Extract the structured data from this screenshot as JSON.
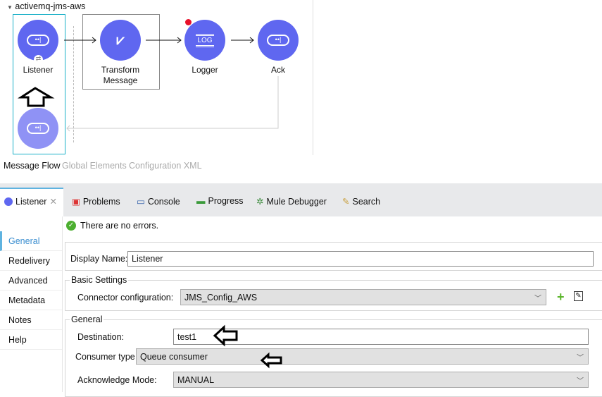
{
  "flow": {
    "name": "activemq-jms-aws",
    "nodes": [
      {
        "label": "Listener"
      },
      {
        "label": "Transform Message"
      },
      {
        "label": "Logger"
      },
      {
        "label": "Ack"
      }
    ]
  },
  "editor_tabs": [
    "Message Flow",
    "Global Elements",
    "Configuration XML"
  ],
  "panel_tabs": [
    {
      "label": "Listener"
    },
    {
      "label": "Problems"
    },
    {
      "label": "Console"
    },
    {
      "label": "Progress"
    },
    {
      "label": "Mule Debugger"
    },
    {
      "label": "Search"
    }
  ],
  "status": "There are no errors.",
  "nav": [
    "General",
    "Redelivery",
    "Advanced",
    "Metadata",
    "Notes",
    "Help"
  ],
  "form": {
    "display_name_label": "Display Name:",
    "display_name": "Listener",
    "basic_settings": "Basic Settings",
    "connector_label": "Connector configuration:",
    "connector": "JMS_Config_AWS",
    "general": "General",
    "destination_label": "Destination:",
    "destination": "test1",
    "consumer_label": "Consumer type",
    "consumer": "Queue consumer",
    "ack_label": "Acknowledge Mode:",
    "ack": "MANUAL"
  },
  "colors": {
    "node": "#5f67f0",
    "node_light": "#8f92f5",
    "selection": "#1ab0c8"
  }
}
